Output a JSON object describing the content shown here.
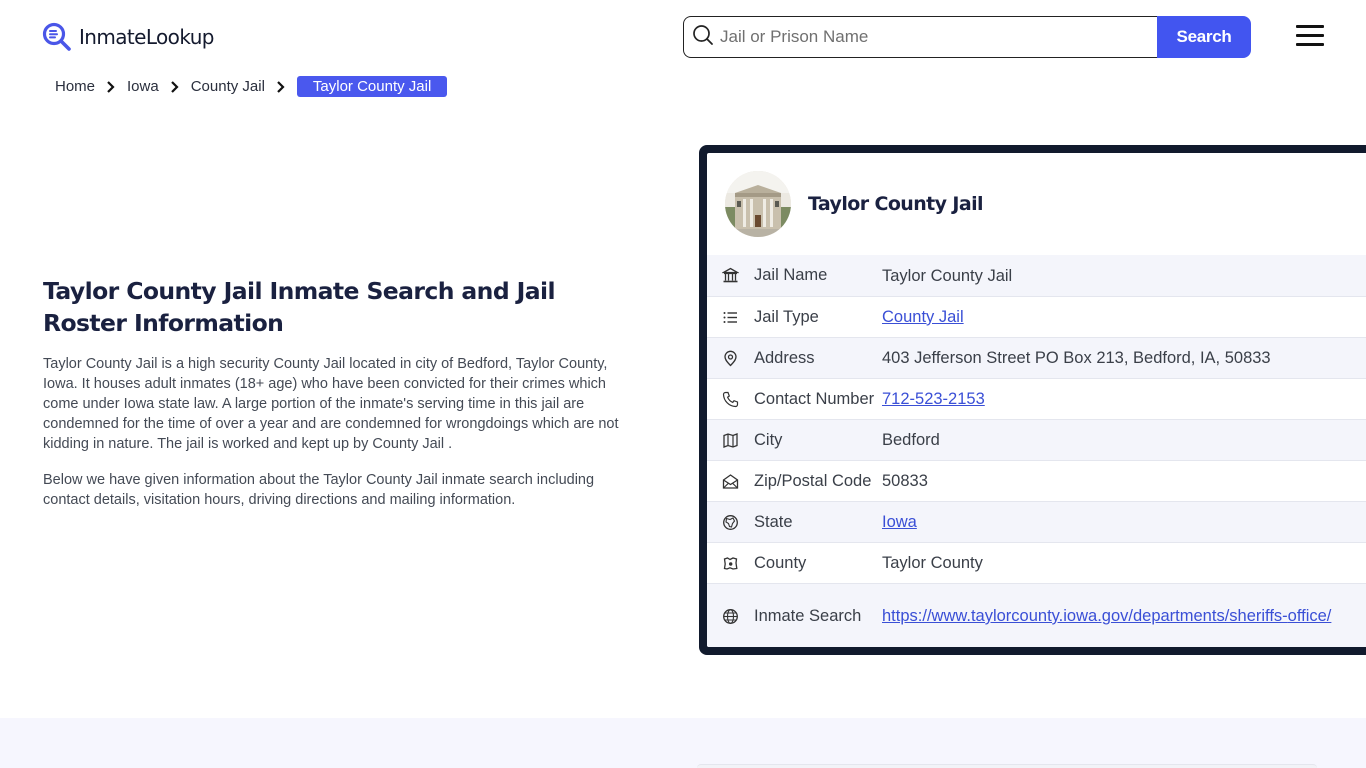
{
  "header": {
    "logo_text": "InmateLookup",
    "search_placeholder": "Jail or Prison Name",
    "search_value": "",
    "search_button": "Search",
    "brand_color": "#4255f0"
  },
  "breadcrumb": {
    "items": [
      "Home",
      "Iowa",
      "County Jail"
    ],
    "active": "Taylor County Jail"
  },
  "main": {
    "title": "Taylor County Jail Inmate Search and Jail Roster Information",
    "paragraphs": [
      "Taylor County Jail is a high security County Jail located in city of Bedford, Taylor County, Iowa. It houses adult inmates (18+ age) who have been convicted for their crimes which come under Iowa state law. A large portion of the inmate's serving time in this jail are condemned for the time of over a year and are condemned for wrongdoings which are not kidding in nature. The jail is worked and kept up by County Jail .",
      "Below we have given information about the Taylor County Jail inmate search including contact details, visitation hours, driving directions and mailing information."
    ]
  },
  "card": {
    "title": "Taylor County Jail",
    "rows": [
      {
        "icon": "building-columns-icon",
        "label": "Jail Name",
        "value": "Taylor County Jail",
        "link": false
      },
      {
        "icon": "list-icon",
        "label": "Jail Type",
        "value": "County Jail",
        "link": true
      },
      {
        "icon": "map-pin-icon",
        "label": "Address",
        "value": "403 Jefferson Street PO Box 213, Bedford, IA, 50833",
        "link": false
      },
      {
        "icon": "phone-icon",
        "label": "Contact Number",
        "value": "712-523-2153",
        "link": true
      },
      {
        "icon": "map-icon",
        "label": "City",
        "value": "Bedford",
        "link": false
      },
      {
        "icon": "mail-open-icon",
        "label": "Zip/Postal Code",
        "value": "50833",
        "link": false
      },
      {
        "icon": "state-globe-icon",
        "label": "State",
        "value": "Iowa",
        "link": true
      },
      {
        "icon": "county-map-icon",
        "label": "County",
        "value": "Taylor County",
        "link": false
      },
      {
        "icon": "globe-icon",
        "label": "Inmate Search",
        "value": "https://www.taylorcounty.iowa.gov/departments/sheriffs-office/",
        "link": true
      }
    ]
  }
}
